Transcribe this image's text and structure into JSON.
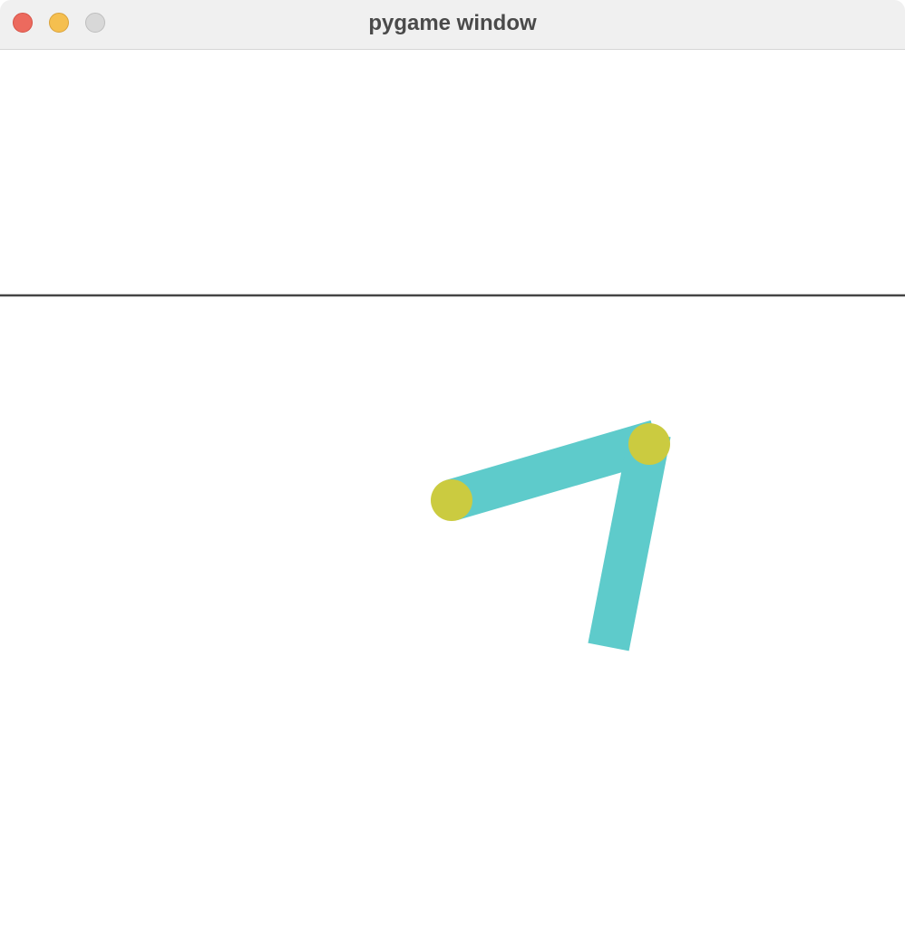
{
  "window": {
    "title": "pygame window"
  },
  "colors": {
    "arm": "#5ecbcb",
    "joint": "#cbcb40",
    "ground": "#444444"
  }
}
